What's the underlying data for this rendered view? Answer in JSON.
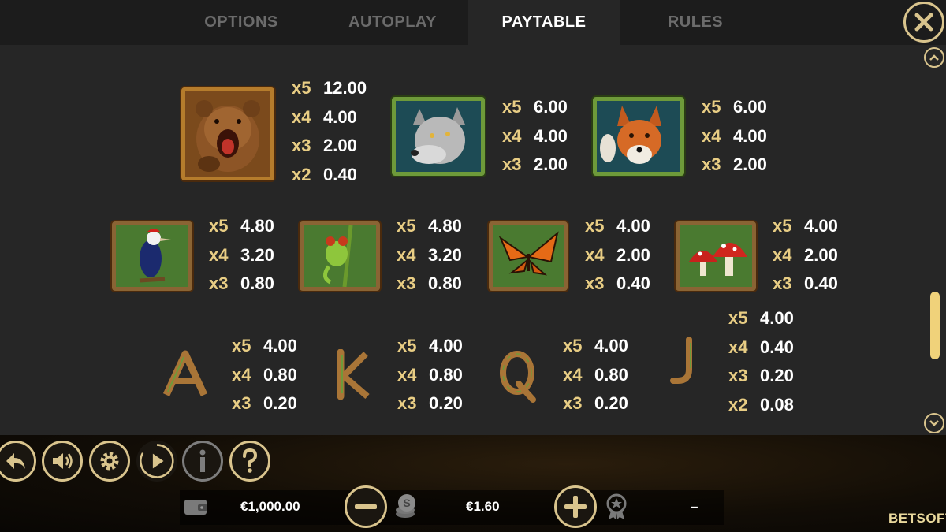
{
  "tabs": [
    {
      "label": "OPTIONS",
      "active": false
    },
    {
      "label": "AUTOPLAY",
      "active": false
    },
    {
      "label": "PAYTABLE",
      "active": true
    },
    {
      "label": "RULES",
      "active": false
    }
  ],
  "paytable": {
    "row1": [
      {
        "symbol": "bear",
        "pays": [
          {
            "mult": "x5",
            "value": "12.00"
          },
          {
            "mult": "x4",
            "value": "4.00"
          },
          {
            "mult": "x3",
            "value": "2.00"
          },
          {
            "mult": "x2",
            "value": "0.40"
          }
        ]
      },
      {
        "symbol": "wolf",
        "pays": [
          {
            "mult": "x5",
            "value": "6.00"
          },
          {
            "mult": "x4",
            "value": "4.00"
          },
          {
            "mult": "x3",
            "value": "2.00"
          }
        ]
      },
      {
        "symbol": "fox",
        "pays": [
          {
            "mult": "x5",
            "value": "6.00"
          },
          {
            "mult": "x4",
            "value": "4.00"
          },
          {
            "mult": "x3",
            "value": "2.00"
          }
        ]
      }
    ],
    "row2": [
      {
        "symbol": "woodpecker",
        "pays": [
          {
            "mult": "x5",
            "value": "4.80"
          },
          {
            "mult": "x4",
            "value": "3.20"
          },
          {
            "mult": "x3",
            "value": "0.80"
          }
        ]
      },
      {
        "symbol": "frog",
        "pays": [
          {
            "mult": "x5",
            "value": "4.80"
          },
          {
            "mult": "x4",
            "value": "3.20"
          },
          {
            "mult": "x3",
            "value": "0.80"
          }
        ]
      },
      {
        "symbol": "butterfly",
        "pays": [
          {
            "mult": "x5",
            "value": "4.00"
          },
          {
            "mult": "x4",
            "value": "2.00"
          },
          {
            "mult": "x3",
            "value": "0.40"
          }
        ]
      },
      {
        "symbol": "mushroom",
        "pays": [
          {
            "mult": "x5",
            "value": "4.00"
          },
          {
            "mult": "x4",
            "value": "2.00"
          },
          {
            "mult": "x3",
            "value": "0.40"
          }
        ]
      }
    ],
    "row3": [
      {
        "symbol": "A",
        "pays": [
          {
            "mult": "x5",
            "value": "4.00"
          },
          {
            "mult": "x4",
            "value": "0.80"
          },
          {
            "mult": "x3",
            "value": "0.20"
          }
        ]
      },
      {
        "symbol": "K",
        "pays": [
          {
            "mult": "x5",
            "value": "4.00"
          },
          {
            "mult": "x4",
            "value": "0.80"
          },
          {
            "mult": "x3",
            "value": "0.20"
          }
        ]
      },
      {
        "symbol": "Q",
        "pays": [
          {
            "mult": "x5",
            "value": "4.00"
          },
          {
            "mult": "x4",
            "value": "0.80"
          },
          {
            "mult": "x3",
            "value": "0.20"
          }
        ]
      },
      {
        "symbol": "J",
        "pays": [
          {
            "mult": "x5",
            "value": "4.00"
          },
          {
            "mult": "x4",
            "value": "0.40"
          },
          {
            "mult": "x3",
            "value": "0.20"
          },
          {
            "mult": "x2",
            "value": "0.08"
          }
        ]
      }
    ]
  },
  "controls": {
    "balance": "€1,000.00",
    "bet": "€1.60",
    "win": "–",
    "brand_part1": "BET",
    "brand_part2": "SOFT"
  },
  "icons": [
    "close-icon",
    "back-icon",
    "sound-icon",
    "settings-icon",
    "autoplay-icon",
    "info-icon",
    "help-icon",
    "wallet-icon",
    "minus-icon",
    "coins-icon",
    "plus-icon",
    "award-icon",
    "chevron-up-icon",
    "chevron-down-icon"
  ],
  "colors": {
    "accent": "#d9c48d",
    "multiplier": "#e8cd84",
    "scroll_thumb": "#f0d27a",
    "panel": "#262626",
    "tabbar": "#1c1c1c"
  }
}
